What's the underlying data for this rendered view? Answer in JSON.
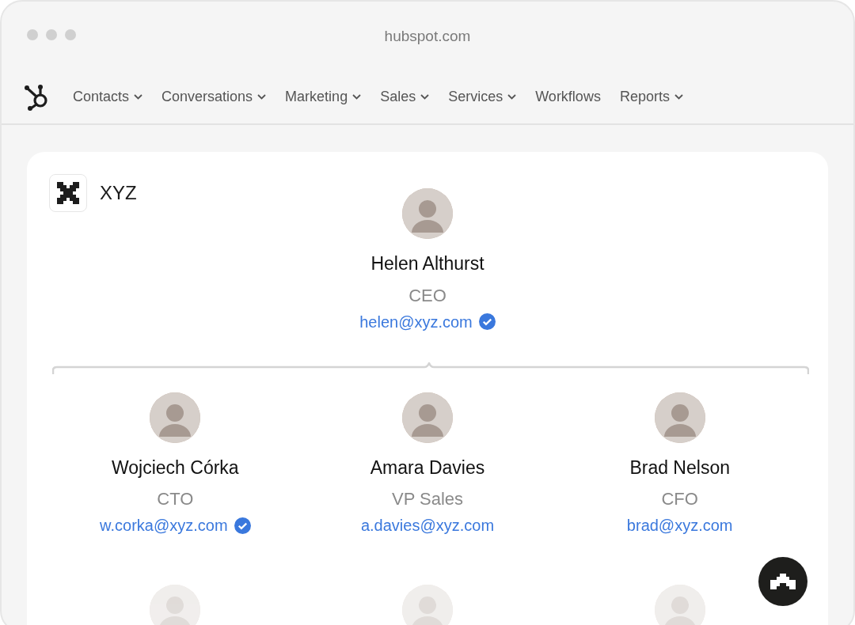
{
  "browser": {
    "url": "hubspot.com"
  },
  "nav": [
    {
      "label": "Contacts",
      "dropdown": true
    },
    {
      "label": "Conversations",
      "dropdown": true
    },
    {
      "label": "Marketing",
      "dropdown": true
    },
    {
      "label": "Sales",
      "dropdown": true
    },
    {
      "label": "Services",
      "dropdown": true
    },
    {
      "label": "Workflows",
      "dropdown": false
    },
    {
      "label": "Reports",
      "dropdown": true
    }
  ],
  "company": {
    "name": "XYZ"
  },
  "ceo": {
    "name": "Helen Althurst",
    "title": "CEO",
    "email": "helen@xyz.com",
    "verified": true
  },
  "reports": [
    {
      "name": "Wojciech Córka",
      "title": "CTO",
      "email": "w.corka@xyz.com",
      "verified": true
    },
    {
      "name": "Amara Davies",
      "title": "VP Sales",
      "email": "a.davies@xyz.com",
      "verified": false
    },
    {
      "name": "Brad Nelson",
      "title": "CFO",
      "email": "brad@xyz.com",
      "verified": false
    }
  ]
}
